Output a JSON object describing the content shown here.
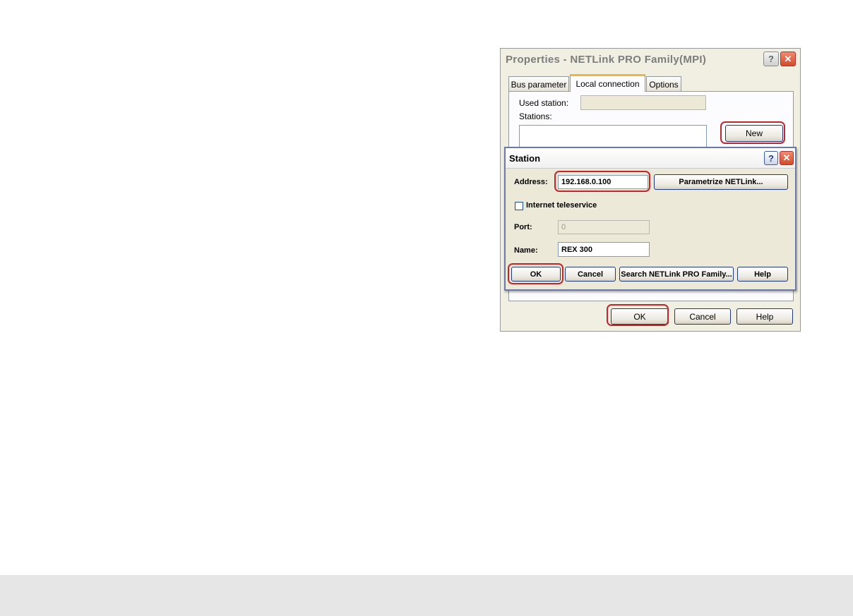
{
  "properties_dialog": {
    "title": "Properties - NETLink PRO Family(MPI)",
    "help_caption": "?",
    "close_caption": "✕",
    "tabs": [
      {
        "label": "Bus parameter",
        "active": false
      },
      {
        "label": "Local connection",
        "active": true
      },
      {
        "label": "Options",
        "active": false
      }
    ],
    "used_station_label": "Used station:",
    "used_station_value": "",
    "stations_label": "Stations:",
    "new_button": "New",
    "ok_button": "OK",
    "cancel_button": "Cancel",
    "help_button": "Help"
  },
  "station_dialog": {
    "title": "Station",
    "help_caption": "?",
    "close_caption": "✕",
    "address_label": "Address:",
    "address_value": "192.168.0.100",
    "parametrize_button": "Parametrize NETLink...",
    "internet_teleservice_label": "Internet teleservice",
    "internet_teleservice_checked": false,
    "port_label": "Port:",
    "port_value": "0",
    "name_label": "Name:",
    "name_value": "REX 300",
    "ok_button": "OK",
    "cancel_button": "Cancel",
    "search_button": "Search NETLink PRO Family...",
    "help_button": "Help"
  },
  "colors": {
    "highlight": "#c0272d",
    "active_tab_accent": "#f5b43b",
    "footer_band": "#e6e6e6"
  }
}
